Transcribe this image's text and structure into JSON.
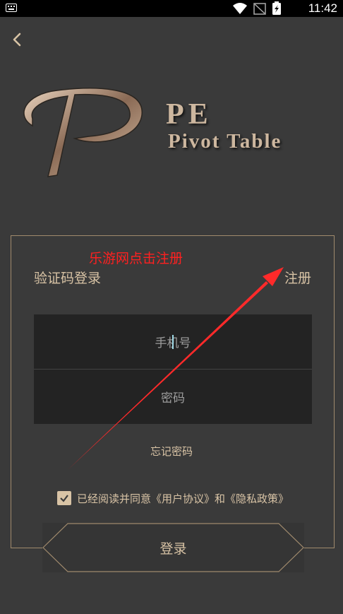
{
  "status_bar": {
    "time": "11:42"
  },
  "logo": {
    "letter": "P",
    "pe": "PE",
    "subtitle": "Pivot Table"
  },
  "annotation": "乐游网点击注册",
  "login": {
    "sms_login": "验证码登录",
    "register": "注册",
    "phone_placeholder": "手机号",
    "password_placeholder": "密码",
    "forgot_password": "忘记密码",
    "agree_text": "已经阅读并同意《用户协议》和《隐私政策》",
    "agree_checked": true,
    "submit": "登录"
  },
  "colors": {
    "background": "#3a3a3a",
    "accent": "#d8c3a5",
    "annotation": "#ff2020",
    "field_bg": "#232323"
  }
}
